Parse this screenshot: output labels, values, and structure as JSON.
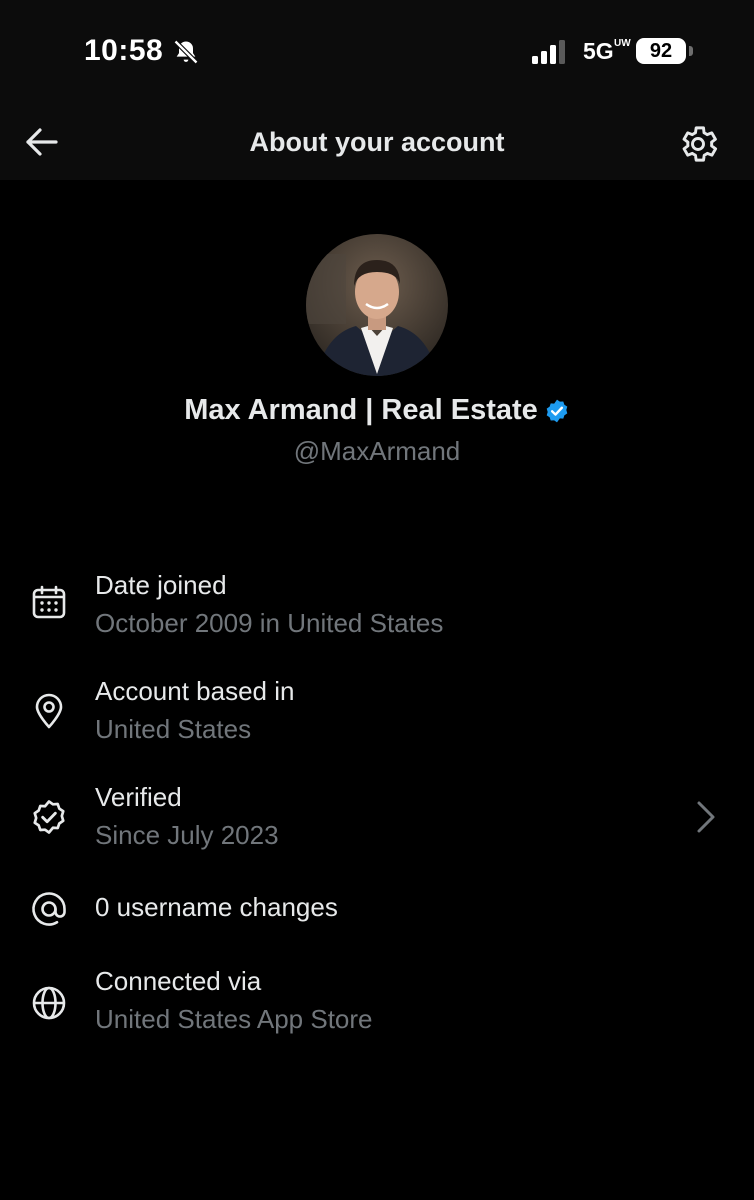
{
  "status_bar": {
    "time": "10:58",
    "network": "5G",
    "network_suffix": "UW",
    "battery": "92",
    "icons": [
      "bell-mute-icon",
      "signal-icon",
      "battery-icon"
    ]
  },
  "header": {
    "title": "About your account",
    "back_icon": "arrow-left-icon",
    "settings_icon": "gear-icon"
  },
  "profile": {
    "display_name": "Max Armand | Real Estate",
    "handle": "@MaxArmand",
    "verified_badge_color": "#1d9bf0"
  },
  "info_items": [
    {
      "icon": "calendar-icon",
      "title": "Date joined",
      "subtitle": "October 2009 in United States"
    },
    {
      "icon": "location-pin-icon",
      "title": "Account based in",
      "subtitle": "United States"
    },
    {
      "icon": "verified-badge-icon",
      "title": "Verified",
      "subtitle": "Since July 2023",
      "chevron": "chevron-right-icon"
    },
    {
      "icon": "at-sign-icon",
      "title": "0 username changes"
    },
    {
      "icon": "globe-icon",
      "title": "Connected via",
      "subtitle": "United States App Store"
    }
  ],
  "colors": {
    "background": "#000000",
    "header_background": "#0c0c0c",
    "primary_text": "#e7e9ea",
    "secondary_text": "#71767b",
    "accent": "#1d9bf0"
  }
}
